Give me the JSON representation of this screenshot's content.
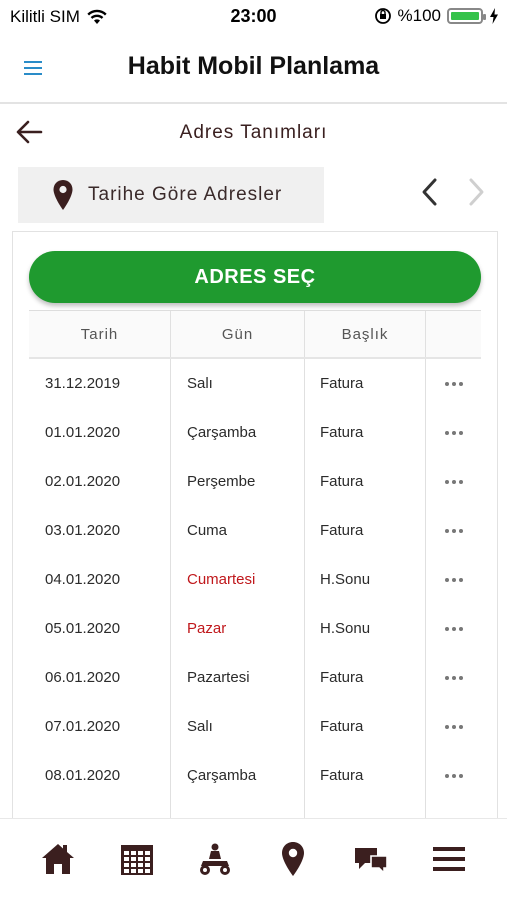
{
  "status_bar": {
    "carrier": "Kilitli SIM",
    "time": "23:00",
    "battery_percent": "%100",
    "battery_level": 1.0,
    "battery_color": "#35c24a"
  },
  "header": {
    "title": "Habit Mobil Planlama",
    "menu_icon": "hamburger-icon",
    "accent_color": "#2a8cc8"
  },
  "page": {
    "title": "Adres Tanımları",
    "back_icon": "arrow-left-icon"
  },
  "tab": {
    "label": "Tarihe Göre Adresler",
    "icon": "map-pin-icon",
    "prev_icon": "chevron-left-icon",
    "next_icon": "chevron-right-icon"
  },
  "select_button": {
    "label": "ADRES SEÇ",
    "color": "#1f9a2f"
  },
  "table": {
    "columns": [
      "Tarih",
      "Gün",
      "Başlık",
      ""
    ],
    "rows": [
      {
        "date": "31.12.2019",
        "day": "Salı",
        "title": "Fatura",
        "weekend": false
      },
      {
        "date": "01.01.2020",
        "day": "Çarşamba",
        "title": "Fatura",
        "weekend": false
      },
      {
        "date": "02.01.2020",
        "day": "Perşembe",
        "title": "Fatura",
        "weekend": false
      },
      {
        "date": "03.01.2020",
        "day": "Cuma",
        "title": "Fatura",
        "weekend": false
      },
      {
        "date": "04.01.2020",
        "day": "Cumartesi",
        "title": "H.Sonu",
        "weekend": true
      },
      {
        "date": "05.01.2020",
        "day": "Pazar",
        "title": "H.Sonu",
        "weekend": true
      },
      {
        "date": "06.01.2020",
        "day": "Pazartesi",
        "title": "Fatura",
        "weekend": false
      },
      {
        "date": "07.01.2020",
        "day": "Salı",
        "title": "Fatura",
        "weekend": false
      },
      {
        "date": "08.01.2020",
        "day": "Çarşamba",
        "title": "Fatura",
        "weekend": false
      }
    ],
    "weekend_color": "#c0181c",
    "more_icon": "more-dots-icon"
  },
  "bottom_nav": {
    "items": [
      {
        "icon": "home-icon"
      },
      {
        "icon": "calendar-icon"
      },
      {
        "icon": "motorcycle-courier-icon"
      },
      {
        "icon": "map-pin-icon"
      },
      {
        "icon": "chat-icon"
      },
      {
        "icon": "menu-icon"
      }
    ],
    "icon_color": "#3b1f1f"
  }
}
